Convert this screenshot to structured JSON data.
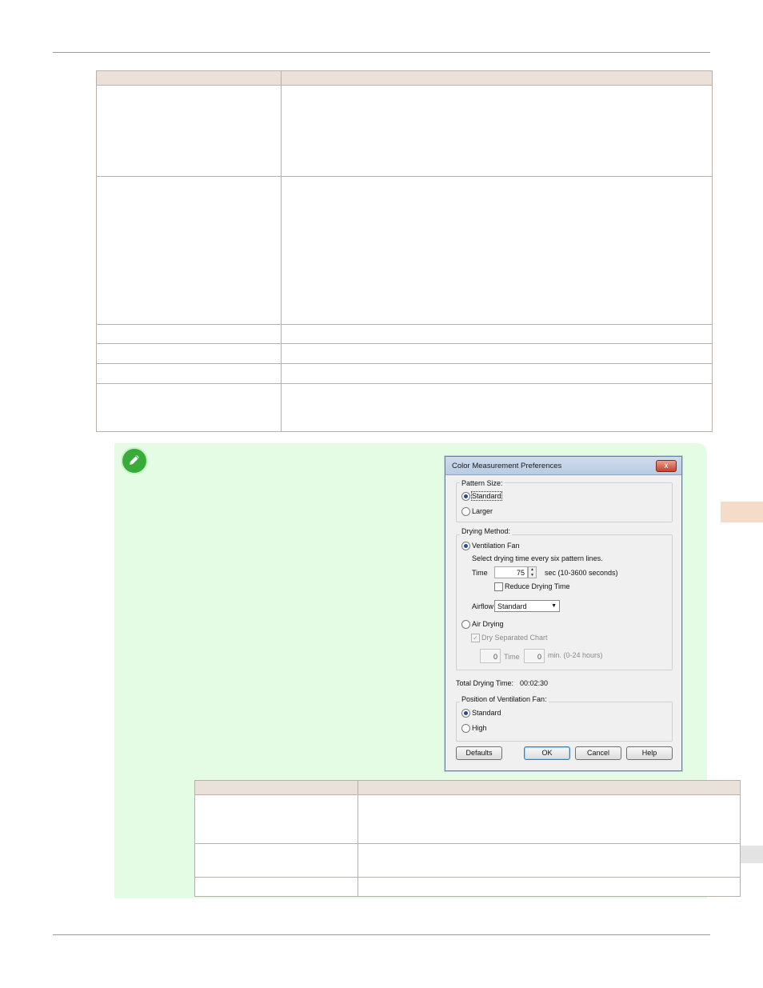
{
  "dialog": {
    "title": "Color Measurement Preferences",
    "close_glyph": "x",
    "pattern_size": {
      "legend": "Pattern Size:",
      "options": [
        "Standard",
        "Larger"
      ],
      "selected": "Standard"
    },
    "drying_method": {
      "legend": "Drying Method:",
      "ventilation_fan_label": "Ventilation Fan",
      "instruction": "Select drying time every six pattern lines.",
      "time_label": "Time",
      "time_value": "75",
      "time_unit": "sec (10-3600 seconds)",
      "reduce_label": "Reduce Drying Time",
      "airflow_label": "Airflow",
      "airflow_value": "Standard",
      "air_drying_label": "Air Drying",
      "dry_separated_label": "Dry Separated Chart",
      "air_time_hours": "0",
      "air_time_label": "Time",
      "air_time_minutes": "0",
      "air_time_unit": "min. (0-24 hours)"
    },
    "total": {
      "label": "Total Drying Time:",
      "value": "00:02:30"
    },
    "fan_position": {
      "legend": "Position of Ventilation Fan:",
      "options": [
        "Standard",
        "High"
      ],
      "selected": "Standard"
    },
    "buttons": {
      "defaults": "Defaults",
      "ok": "OK",
      "cancel": "Cancel",
      "help": "Help"
    }
  },
  "colors": {
    "note_bg": "#e4fbe4",
    "table_header_bg": "#e9e1da",
    "side_tab": "#f4dcc8",
    "note_icon": "#3aaa3a"
  },
  "icons": {
    "note": "pencil-icon"
  }
}
